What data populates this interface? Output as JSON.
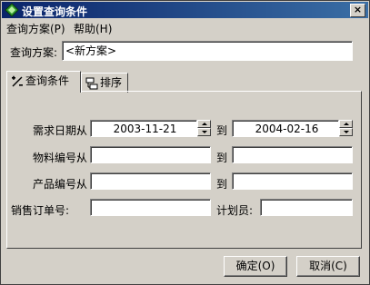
{
  "window": {
    "title": "设置查询条件"
  },
  "menu": {
    "items": [
      "查询方案(P)",
      "帮助(H)"
    ]
  },
  "scheme": {
    "label": "查询方案:",
    "value": "<新方案>"
  },
  "tabs": [
    {
      "label": "查询条件"
    },
    {
      "label": "排序"
    }
  ],
  "conditions": {
    "date": {
      "label": "需求日期:",
      "from": "从",
      "from_value": "2003-11-21",
      "to": "到",
      "to_value": "2004-02-16"
    },
    "material": {
      "label": "物料编号:",
      "from": "从",
      "to": "到",
      "from_value": "",
      "to_value": ""
    },
    "product": {
      "label": "产品编号:",
      "from": "从",
      "to": "到",
      "from_value": "",
      "to_value": ""
    },
    "sales_order": {
      "label": "销售订单号:",
      "value": ""
    },
    "planner": {
      "label": "计划员:",
      "value": ""
    }
  },
  "buttons": {
    "ok": "确定(O)",
    "cancel": "取消(C)"
  }
}
